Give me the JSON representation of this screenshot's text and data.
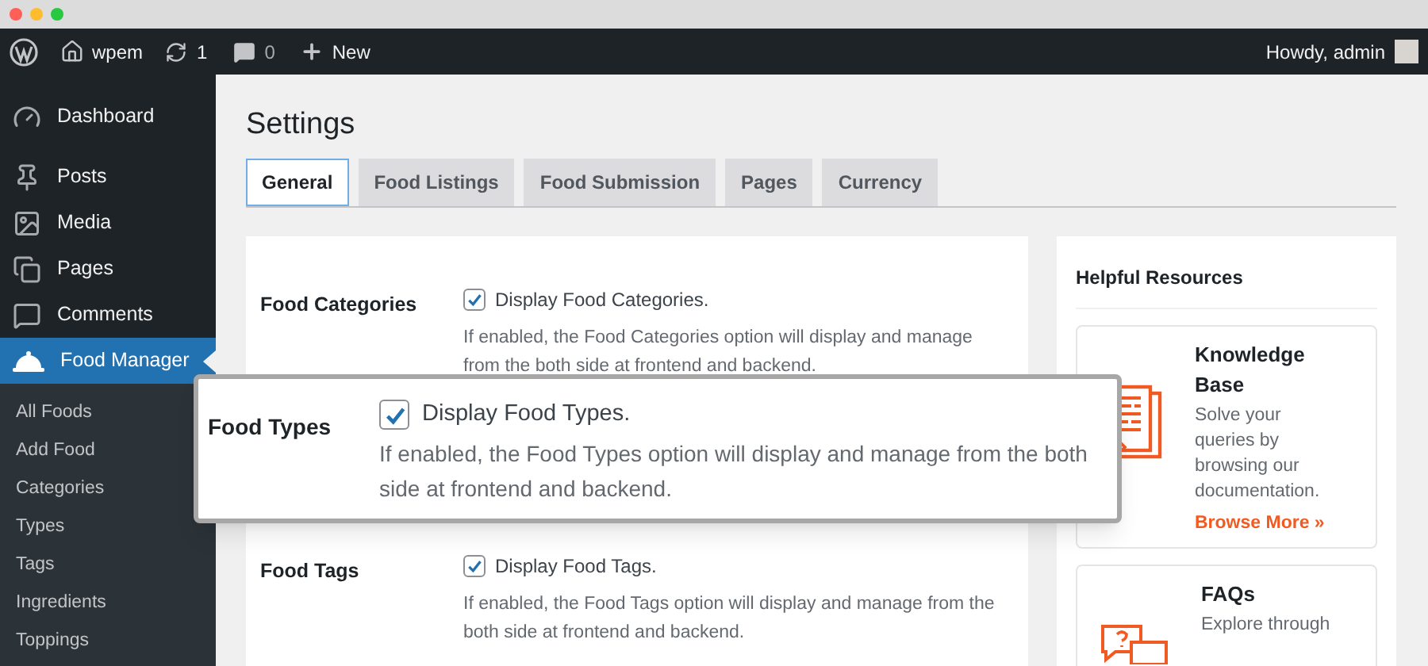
{
  "admin_bar": {
    "site": "wpem",
    "updates": "1",
    "comments": "0",
    "new": "New",
    "greeting": "Howdy, admin"
  },
  "sidebar": {
    "items": [
      {
        "label": "Dashboard",
        "selected": false
      },
      {
        "label": "Posts",
        "selected": false
      },
      {
        "label": "Media",
        "selected": false
      },
      {
        "label": "Pages",
        "selected": false
      },
      {
        "label": "Comments",
        "selected": false
      },
      {
        "label": "Food Manager",
        "selected": true
      }
    ],
    "submenu": [
      "All Foods",
      "Add Food",
      "Categories",
      "Types",
      "Tags",
      "Ingredients",
      "Toppings"
    ]
  },
  "page_title": "Settings",
  "tabs": [
    {
      "label": "General",
      "selected": true
    },
    {
      "label": "Food Listings",
      "selected": false
    },
    {
      "label": "Food Submission",
      "selected": false
    },
    {
      "label": "Pages",
      "selected": false
    },
    {
      "label": "Currency",
      "selected": false
    }
  ],
  "settings": [
    {
      "kind": "normal",
      "label": "Food Categories",
      "checked": true,
      "option": "Display Food Categories.",
      "description": "If enabled, the Food Categories option will display and manage from the both side at frontend and backend."
    },
    {
      "kind": "callout",
      "label": "Food Types",
      "checked": true,
      "option": "Display Food Types.",
      "description": "If enabled, the Food Types option will display and manage from the both side at frontend and backend."
    },
    {
      "kind": "normal",
      "label": "Food Tags",
      "checked": true,
      "option": "Display Food Tags.",
      "description": "If enabled, the Food Tags option will display and manage from the both side at frontend and backend."
    }
  ],
  "resources": {
    "title": "Helpful Resources",
    "cards": [
      {
        "kind": "docs",
        "title": "Knowledge Base",
        "text": "Solve your queries by browsing our documentation.",
        "link": "Browse More »"
      },
      {
        "kind": "faq",
        "title": "FAQs",
        "text": "Explore through"
      }
    ]
  }
}
